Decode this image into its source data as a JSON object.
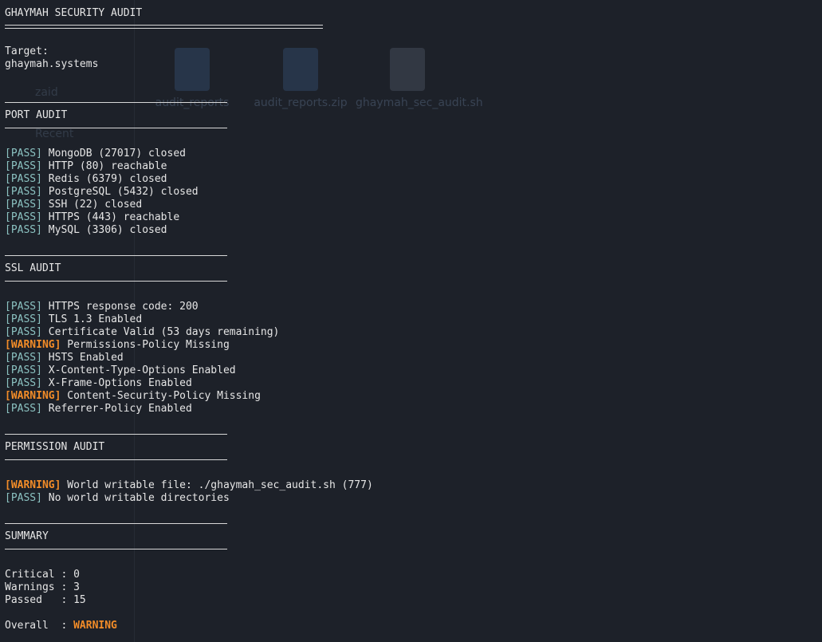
{
  "background_ghost": {
    "sidebar": [
      "zaid",
      "Recent"
    ],
    "files": [
      "audit_reports",
      "audit_reports.zip",
      "ghaymah_sec_audit.sh"
    ]
  },
  "header": {
    "title": "GHAYMAH SECURITY AUDIT",
    "target_label": "Target:",
    "target_value": "ghaymah.systems"
  },
  "sections": {
    "port": {
      "title": "PORT AUDIT",
      "items": [
        {
          "tag": "[PASS]",
          "text": "MongoDB (27017) closed"
        },
        {
          "tag": "[PASS]",
          "text": "HTTP (80) reachable"
        },
        {
          "tag": "[PASS]",
          "text": "Redis (6379) closed"
        },
        {
          "tag": "[PASS]",
          "text": "PostgreSQL (5432) closed"
        },
        {
          "tag": "[PASS]",
          "text": "SSH (22) closed"
        },
        {
          "tag": "[PASS]",
          "text": "HTTPS (443) reachable"
        },
        {
          "tag": "[PASS]",
          "text": "MySQL (3306) closed"
        }
      ]
    },
    "ssl": {
      "title": "SSL AUDIT",
      "items": [
        {
          "tag": "[PASS]",
          "text": "HTTPS response code: 200"
        },
        {
          "tag": "[PASS]",
          "text": "TLS 1.3 Enabled"
        },
        {
          "tag": "[PASS]",
          "text": "Certificate Valid (53 days remaining)"
        },
        {
          "tag": "[WARNING]",
          "text": "Permissions-Policy Missing"
        },
        {
          "tag": "[PASS]",
          "text": "HSTS Enabled"
        },
        {
          "tag": "[PASS]",
          "text": "X-Content-Type-Options Enabled"
        },
        {
          "tag": "[PASS]",
          "text": "X-Frame-Options Enabled"
        },
        {
          "tag": "[WARNING]",
          "text": "Content-Security-Policy Missing"
        },
        {
          "tag": "[PASS]",
          "text": "Referrer-Policy Enabled"
        }
      ]
    },
    "permission": {
      "title": "PERMISSION AUDIT",
      "items": [
        {
          "tag": "[WARNING]",
          "text": "World writable file: ./ghaymah_sec_audit.sh (777)"
        },
        {
          "tag": "[PASS]",
          "text": "No world writable directories"
        }
      ]
    }
  },
  "summary": {
    "title": "SUMMARY",
    "critical_label": "Critical : ",
    "critical_value": "0",
    "warnings_label": "Warnings : ",
    "warnings_value": "3",
    "passed_label": "Passed   : ",
    "passed_value": "15",
    "overall_label": "Overall  : ",
    "overall_value": "WARNING"
  },
  "colors": {
    "background": "#1d2129",
    "text": "#e6e6e6",
    "pass": "#8cc3c2",
    "warning": "#f28c28"
  }
}
